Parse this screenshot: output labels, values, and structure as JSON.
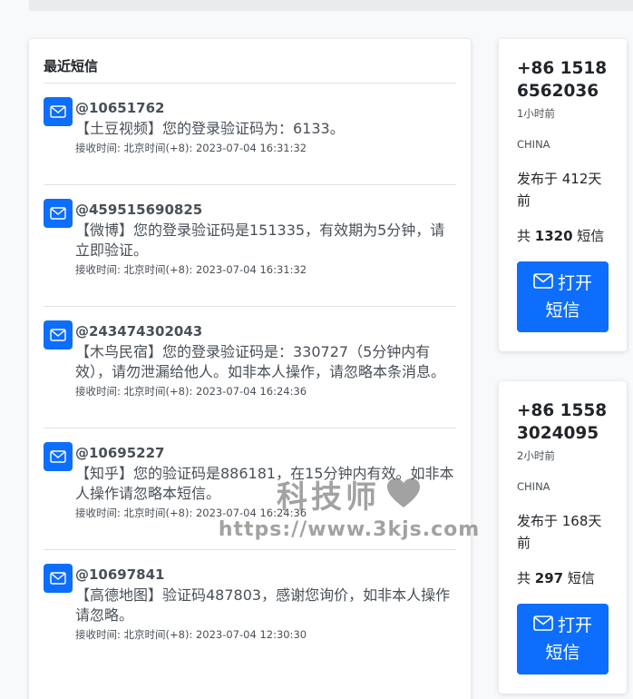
{
  "messages_card": {
    "title": "最近短信",
    "messages": [
      {
        "sender": "@10651762",
        "body": "【土豆视频】您的登录验证码为：6133。",
        "time": "接收时间: 北京时间(+8): 2023-07-04 16:31:32"
      },
      {
        "sender": "@459515690825",
        "body": "【微博】您的登录验证码是151335，有效期为5分钟，请立即验证。",
        "time": "接收时间: 北京时间(+8): 2023-07-04 16:31:32"
      },
      {
        "sender": "@243474302043",
        "body": "【木鸟民宿】您的登录验证码是：330727（5分钟内有效），请勿泄漏给他人。如非本人操作，请忽略本条消息。",
        "time": "接收时间: 北京时间(+8): 2023-07-04 16:24:36"
      },
      {
        "sender": "@10695227",
        "body": "【知乎】您的验证码是886181，在15分钟内有效。如非本人操作请忽略本短信。",
        "time": "接收时间: 北京时间(+8): 2023-07-04 16:24:36"
      },
      {
        "sender": "@10697841",
        "body": "【高德地图】验证码487803，感谢您询价，如非本人操作请忽略。",
        "time": "接收时间: 北京时间(+8): 2023-07-04 12:30:30"
      }
    ]
  },
  "numbers": [
    {
      "phone": "+86 15186562036",
      "ago": "1小时前",
      "country": "CHINA",
      "posted": "发布于 412天前",
      "count_prefix": "共 ",
      "count": "1320",
      "count_suffix": " 短信",
      "button_line1": "打开",
      "button_line2": "短信"
    },
    {
      "phone": "+86 15583024095",
      "ago": "2小时前",
      "country": "CHINA",
      "posted": "发布于 168天前",
      "count_prefix": "共 ",
      "count": "297",
      "count_suffix": " 短信",
      "button_line1": "打开",
      "button_line2": "短信"
    }
  ],
  "watermark": {
    "title": "科技师",
    "url": "https://www.3kjs.com"
  },
  "colors": {
    "accent": "#0d6efd",
    "icon_bg": "#0d6efd",
    "text": "#495057"
  },
  "icons": {
    "message": "envelope-icon",
    "heart": "heart-icon"
  }
}
